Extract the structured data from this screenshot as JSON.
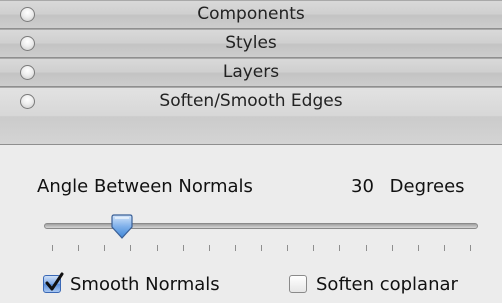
{
  "trays": [
    {
      "label": "Components",
      "expanded": false,
      "icon": "circle-toggle-icon"
    },
    {
      "label": "Styles",
      "expanded": false,
      "icon": "circle-toggle-icon"
    },
    {
      "label": "Layers",
      "expanded": false,
      "icon": "circle-toggle-icon"
    },
    {
      "label": "Soften/Smooth Edges",
      "expanded": true,
      "icon": "circle-toggle-icon"
    }
  ],
  "soften": {
    "angle_label": "Angle Between Normals",
    "angle_value": "30",
    "angle_unit": "Degrees",
    "slider": {
      "min": 0,
      "max": 180,
      "value": 30,
      "tick_count": 17,
      "thumb_color": "#4a8fd8"
    },
    "smooth_normals": {
      "label": "Smooth Normals",
      "checked": true,
      "icon": "checkmark-icon"
    },
    "soften_coplanar": {
      "label": "Soften coplanar",
      "checked": false
    }
  },
  "colors": {
    "panel_bg": "#ececec",
    "tray_border": "#8f8f8f",
    "accent": "#3a68b5"
  }
}
